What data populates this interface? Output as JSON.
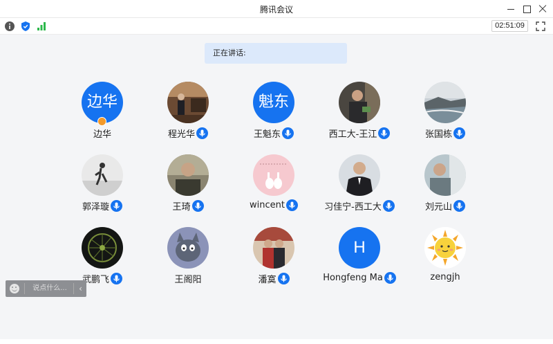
{
  "window": {
    "title": "腾讯会议"
  },
  "toolbar": {
    "info_icon": "info-icon",
    "security_icon": "shield-icon",
    "signal_icon": "signal-icon",
    "timer": "02:51:09",
    "fullscreen_icon": "fullscreen-icon"
  },
  "speaking": {
    "label": "正在讲话:"
  },
  "participants": [
    {
      "name": "边华",
      "avatar_text": "边华",
      "host": true,
      "mic": false
    },
    {
      "name": "程光华",
      "mic": true
    },
    {
      "name": "王魁东",
      "avatar_text": "魁东",
      "mic": true
    },
    {
      "name": "西工大-王江",
      "mic": true
    },
    {
      "name": "张国栋",
      "mic": true
    },
    {
      "name": "郭泽璇",
      "mic": true
    },
    {
      "name": "王琦",
      "mic": true
    },
    {
      "name": "wincent",
      "mic": true
    },
    {
      "name": "习佳宁-西工大",
      "mic": true
    },
    {
      "name": "刘元山",
      "mic": true
    },
    {
      "name": "武鹏飞",
      "mic": true
    },
    {
      "name": "王阁阳",
      "mic": false
    },
    {
      "name": "潘寞",
      "mic": true
    },
    {
      "name": "Hongfeng Ma",
      "avatar_text": "H",
      "mic": true
    },
    {
      "name": "zengjh",
      "mic": false
    }
  ],
  "chat": {
    "placeholder": "说点什么...",
    "collapse": "‹"
  },
  "colors": {
    "accent": "#1673f0",
    "speaking_bg": "#dce9fb",
    "host_badge": "#f39a2b"
  }
}
